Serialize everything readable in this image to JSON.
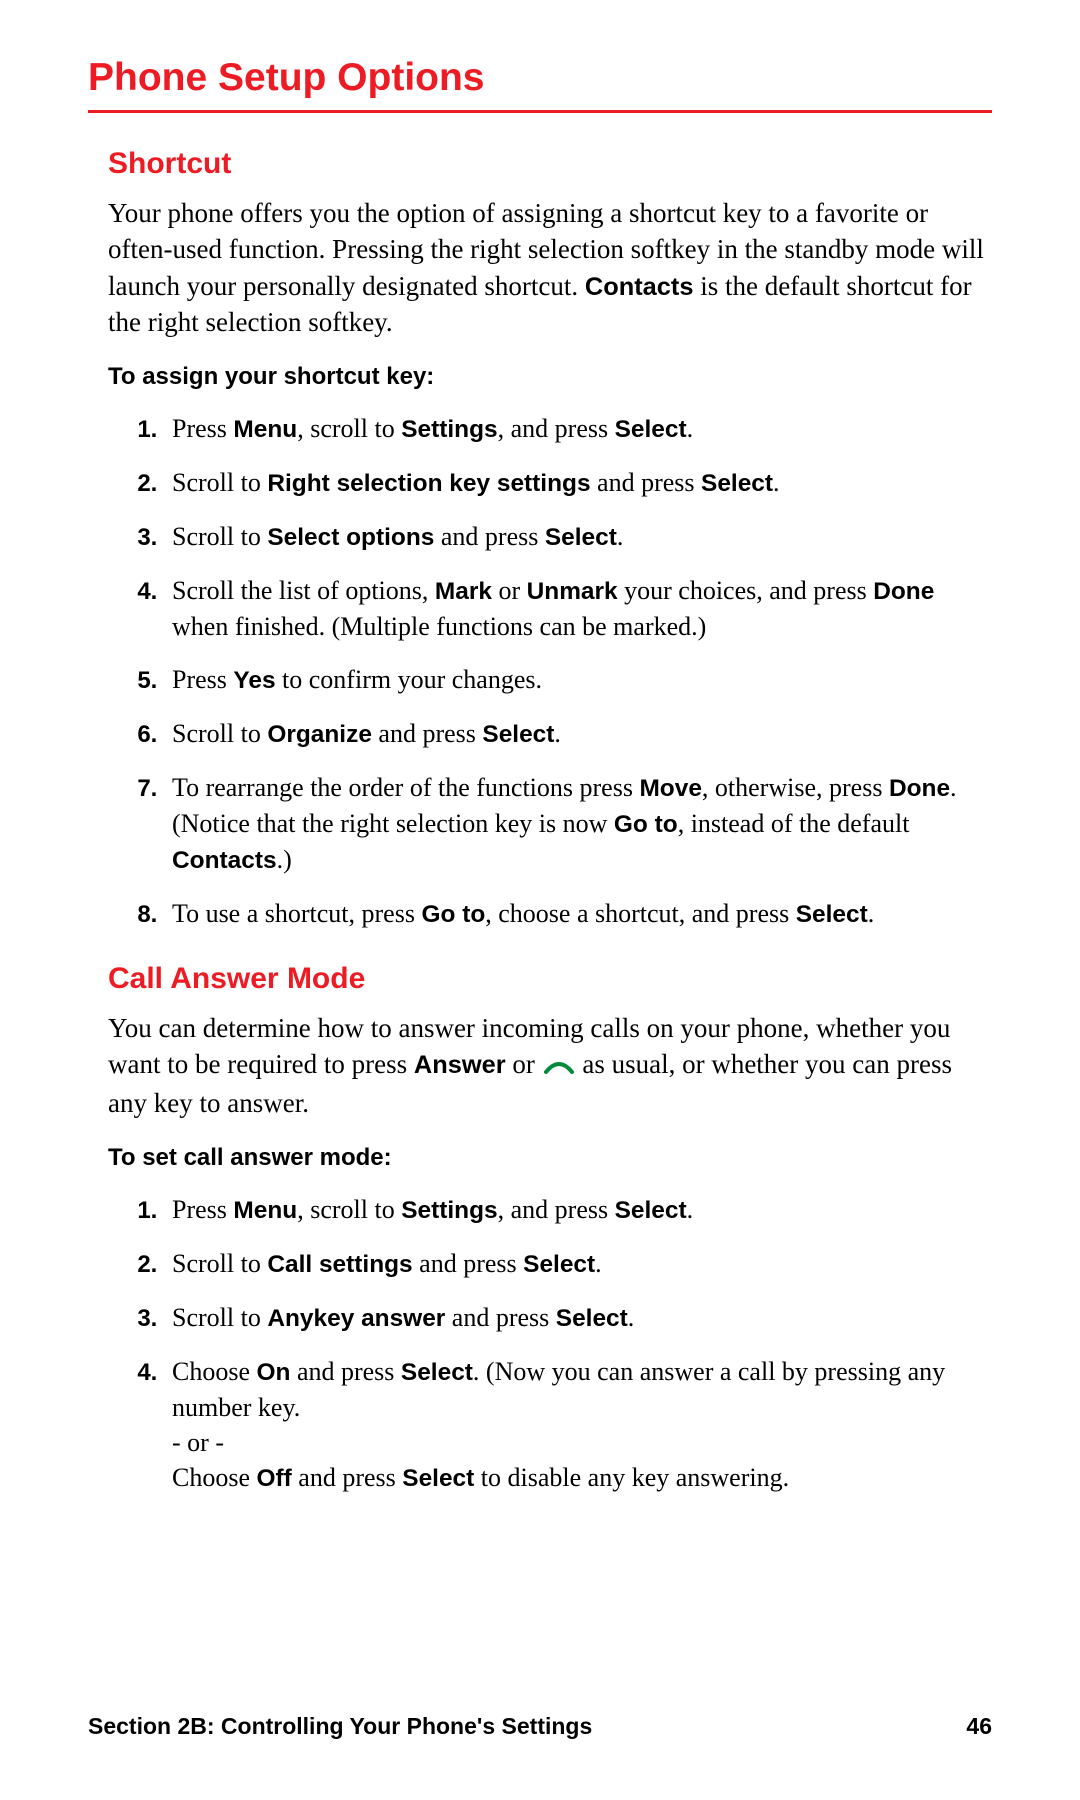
{
  "colors": {
    "accent": "#ed1c24"
  },
  "page_title": "Phone Setup Options",
  "sections": {
    "shortcut": {
      "heading": "Shortcut",
      "intro_html": "Your phone offers you the option of assigning a shortcut key to a favorite or often-used function. Pressing the right selection softkey in the standby mode will launch your personally designated shortcut. <b>Contacts</b> is the default shortcut for the right selection softkey.",
      "subhead": "To assign your shortcut key:",
      "steps_html": [
        "Press <b>Menu</b>, scroll to <b>Settings</b>, and press <b>Select</b>.",
        "Scroll to <b>Right selection key settings</b> and press <b>Select</b>.",
        "Scroll to <b>Select options</b> and press <b>Select</b>.",
        "Scroll the list of options, <b>Mark</b> or <b>Unmark</b> your choices, and press <b>Done</b> when finished. (Multiple functions can be marked.)",
        "Press <b>Yes</b> to confirm your changes.",
        "Scroll to <b>Organize</b> and press <b>Select</b>.",
        "To rearrange the order of the functions press <b>Move</b>, otherwise, press <b>Done</b>. (Notice that the right selection key is now <b>Go to</b>, instead of the default <b>Contacts</b>.)",
        "To use a shortcut, press <b>Go to</b>, choose a shortcut, and press <b>Select</b>."
      ]
    },
    "call_answer": {
      "heading": "Call Answer Mode",
      "intro_html": "You can determine how to answer incoming calls on your phone, whether you want to be required to press <b>Answer</b> or <span class=\"call-key\" data-name=\"call-key-icon\" data-interactable=\"false\"><svg width=\"30\" height=\"16\" viewBox=\"0 0 30 16\"><path d=\"M2 12 Q15 -4 28 12\" stroke=\"#008a3a\" stroke-width=\"4\" fill=\"none\" stroke-linecap=\"round\"/></svg></span> as usual, or whether you can press any key to answer.",
      "subhead": "To set call answer mode:",
      "steps_html": [
        "Press <b>Menu</b>, scroll to <b>Settings</b>, and press <b>Select</b>.",
        "Scroll to <b>Call settings</b> and press <b>Select</b>.",
        "Scroll to <b>Anykey answer</b> and press <b>Select</b>.",
        "Choose <b>On</b> and press <b>Select</b>. (Now you can answer a call by pressing any number key.<br>- or -<br>Choose <b>Off</b> and press <b>Select</b> to disable any key answering."
      ]
    }
  },
  "footer": {
    "section_label": "Section 2B: Controlling Your Phone's Settings",
    "page_number": "46"
  }
}
